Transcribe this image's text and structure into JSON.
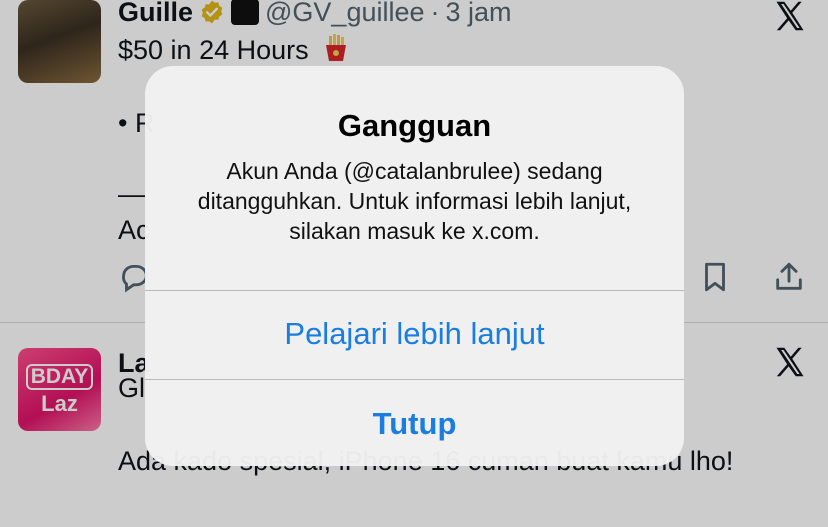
{
  "tweets": [
    {
      "author_name": "Guille",
      "handle": "@GV_guillee",
      "separator": "·",
      "time": "3 jam",
      "lines": [
        "$50 in 24 Hours",
        "• R",
        "—",
        "Ac"
      ]
    },
    {
      "author_name": "La",
      "avatar_text": [
        "BDAY",
        "Laz"
      ],
      "lines": [
        "Gl",
        "Ada kado spesial, iPhone 16 cuman buat kamu lho!"
      ]
    }
  ],
  "alert": {
    "title": "Gangguan",
    "message": "Akun Anda (@catalanbrulee) sedang ditangguhkan. Untuk informasi lebih lanjut, silakan masuk ke x.com.",
    "primary_button": "Pelajari lebih lanjut",
    "close_button": "Tutup"
  },
  "colors": {
    "link_blue": "#1a7de0",
    "verified_gold": "#e2b719",
    "handle_gray": "#536471"
  },
  "icons": [
    "verified-badge-icon",
    "affiliate-badge-icon",
    "x-logo-icon",
    "reply-icon",
    "bookmark-icon",
    "share-icon",
    "fries-emoji-icon"
  ]
}
